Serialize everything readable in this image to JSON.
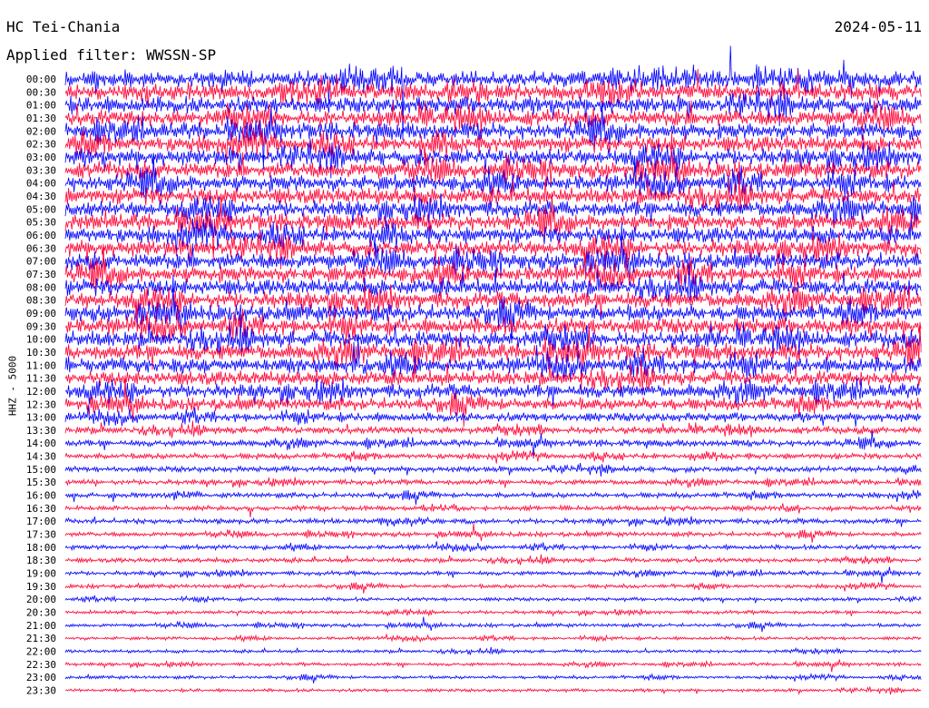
{
  "header": {
    "station": "HC Tei-Chania",
    "filter": "Applied filter: WWSSN-SP",
    "date": "2024-05-11",
    "channel": "HHZ - 5000"
  },
  "colors": {
    "trace_a": "#0000ff",
    "trace_b": "#ff0033",
    "background": "#ffffff",
    "text": "#000000"
  },
  "chart_data": {
    "type": "line",
    "title": "HC Tei-Chania",
    "ylabel": "HHZ - 5000",
    "xlabel": "",
    "grid": false,
    "rows": [
      {
        "label": "00:00",
        "color": "#0000ff",
        "amplitude": 1.0
      },
      {
        "label": "00:30",
        "color": "#ff0033",
        "amplitude": 1.0
      },
      {
        "label": "01:00",
        "color": "#0000ff",
        "amplitude": 1.0
      },
      {
        "label": "01:30",
        "color": "#ff0033",
        "amplitude": 1.0
      },
      {
        "label": "02:00",
        "color": "#0000ff",
        "amplitude": 1.0
      },
      {
        "label": "02:30",
        "color": "#ff0033",
        "amplitude": 1.0
      },
      {
        "label": "03:00",
        "color": "#0000ff",
        "amplitude": 1.0
      },
      {
        "label": "03:30",
        "color": "#ff0033",
        "amplitude": 1.0
      },
      {
        "label": "04:00",
        "color": "#0000ff",
        "amplitude": 1.0
      },
      {
        "label": "04:30",
        "color": "#ff0033",
        "amplitude": 1.0
      },
      {
        "label": "05:00",
        "color": "#0000ff",
        "amplitude": 1.0
      },
      {
        "label": "05:30",
        "color": "#ff0033",
        "amplitude": 1.0
      },
      {
        "label": "06:00",
        "color": "#0000ff",
        "amplitude": 1.0
      },
      {
        "label": "06:30",
        "color": "#ff0033",
        "amplitude": 1.0
      },
      {
        "label": "07:00",
        "color": "#0000ff",
        "amplitude": 1.0
      },
      {
        "label": "07:30",
        "color": "#ff0033",
        "amplitude": 1.0
      },
      {
        "label": "08:00",
        "color": "#0000ff",
        "amplitude": 1.0
      },
      {
        "label": "08:30",
        "color": "#ff0033",
        "amplitude": 1.0
      },
      {
        "label": "09:00",
        "color": "#0000ff",
        "amplitude": 1.0
      },
      {
        "label": "09:30",
        "color": "#ff0033",
        "amplitude": 1.0
      },
      {
        "label": "10:00",
        "color": "#0000ff",
        "amplitude": 1.0
      },
      {
        "label": "10:30",
        "color": "#ff0033",
        "amplitude": 1.0
      },
      {
        "label": "11:00",
        "color": "#0000ff",
        "amplitude": 0.95
      },
      {
        "label": "11:30",
        "color": "#ff0033",
        "amplitude": 0.9
      },
      {
        "label": "12:00",
        "color": "#0000ff",
        "amplitude": 0.85
      },
      {
        "label": "12:30",
        "color": "#ff0033",
        "amplitude": 0.75
      },
      {
        "label": "13:00",
        "color": "#0000ff",
        "amplitude": 0.55
      },
      {
        "label": "13:30",
        "color": "#ff0033",
        "amplitude": 0.45
      },
      {
        "label": "14:00",
        "color": "#0000ff",
        "amplitude": 0.4
      },
      {
        "label": "14:30",
        "color": "#ff0033",
        "amplitude": 0.35
      },
      {
        "label": "15:00",
        "color": "#0000ff",
        "amplitude": 0.35
      },
      {
        "label": "15:30",
        "color": "#ff0033",
        "amplitude": 0.32
      },
      {
        "label": "16:00",
        "color": "#0000ff",
        "amplitude": 0.32
      },
      {
        "label": "16:30",
        "color": "#ff0033",
        "amplitude": 0.3
      },
      {
        "label": "17:00",
        "color": "#0000ff",
        "amplitude": 0.32
      },
      {
        "label": "17:30",
        "color": "#ff0033",
        "amplitude": 0.28
      },
      {
        "label": "18:00",
        "color": "#0000ff",
        "amplitude": 0.28
      },
      {
        "label": "18:30",
        "color": "#ff0033",
        "amplitude": 0.28
      },
      {
        "label": "19:00",
        "color": "#0000ff",
        "amplitude": 0.26
      },
      {
        "label": "19:30",
        "color": "#ff0033",
        "amplitude": 0.24
      },
      {
        "label": "20:00",
        "color": "#0000ff",
        "amplitude": 0.22
      },
      {
        "label": "20:30",
        "color": "#ff0033",
        "amplitude": 0.22
      },
      {
        "label": "21:00",
        "color": "#0000ff",
        "amplitude": 0.22
      },
      {
        "label": "21:30",
        "color": "#ff0033",
        "amplitude": 0.2
      },
      {
        "label": "22:00",
        "color": "#0000ff",
        "amplitude": 0.2
      },
      {
        "label": "22:30",
        "color": "#ff0033",
        "amplitude": 0.2
      },
      {
        "label": "23:00",
        "color": "#0000ff",
        "amplitude": 0.2
      },
      {
        "label": "23:30",
        "color": "#ff0033",
        "amplitude": 0.2
      }
    ]
  }
}
